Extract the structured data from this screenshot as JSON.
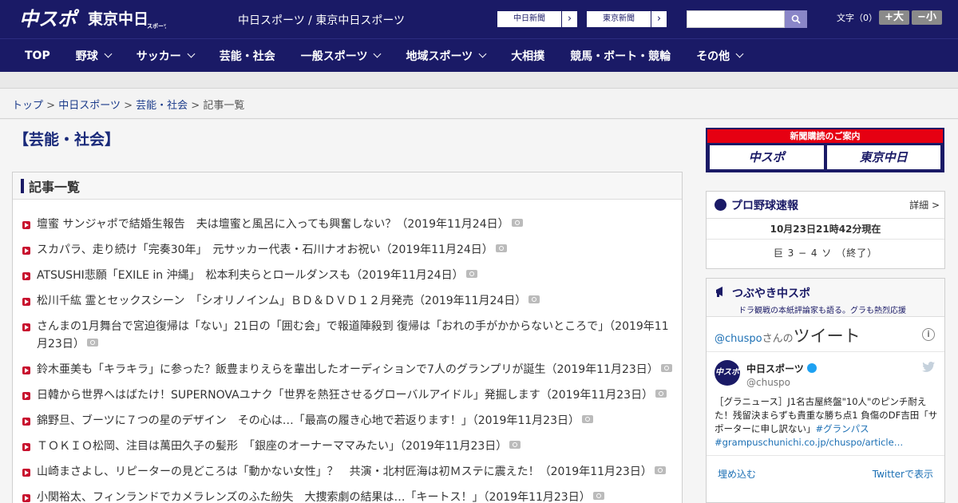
{
  "header": {
    "site_names": "中日スポーツ / 東京中日スポーツ",
    "logo_chuspo": "中スポ",
    "logo_tokyo": "東京中日",
    "logo_tokyo_small": "スポーツ",
    "ext_link_1": "中日新聞",
    "ext_link_2": "東京新聞",
    "search_placeholder": "",
    "fontsize_label": "文字（0）",
    "font_larger": "+大",
    "font_smaller": "−小"
  },
  "nav": {
    "items": [
      {
        "label": "TOP",
        "dropdown": false
      },
      {
        "label": "野球",
        "dropdown": true
      },
      {
        "label": "サッカー",
        "dropdown": true
      },
      {
        "label": "芸能・社会",
        "dropdown": false
      },
      {
        "label": "一般スポーツ",
        "dropdown": true
      },
      {
        "label": "地域スポーツ",
        "dropdown": true
      },
      {
        "label": "大相撲",
        "dropdown": false
      },
      {
        "label": "競馬・ボート・競輪",
        "dropdown": false
      },
      {
        "label": "その他",
        "dropdown": true
      }
    ]
  },
  "breadcrumb": {
    "items": [
      "トップ",
      "中日スポーツ",
      "芸能・社会"
    ],
    "separator": ">",
    "current": "記事一覧"
  },
  "page": {
    "title": "【芸能・社会】",
    "list_title": "記事一覧"
  },
  "articles": [
    {
      "text": "壇蜜 サンジャポで結婚生報告　夫は壇蜜と風呂に入っても興奮しない？（2019年11月24日）",
      "photo": true
    },
    {
      "text": "スカパラ、走り続け「完奏30年」　元サッカー代表・石川ナオお祝い（2019年11月24日）",
      "photo": true
    },
    {
      "text": "ATSUSHI悲願「EXILE in 沖縄」　松本利夫らとロールダンスも（2019年11月24日）",
      "photo": true
    },
    {
      "text": "松川千紘 霊とセックスシーン　「シオリノインム」ＢＤ＆ＤＶＤ１２月発売（2019年11月24日）",
      "photo": true
    },
    {
      "text": "さんまの1月舞台で宮迫復帰は「ない」21日の「囲む会」で報道陣殺到 復帰は「おれの手がかからないところで」（2019年11月23日）",
      "photo": true
    },
    {
      "text": "鈴木亜美も「キラキラ」に参った？飯豊まりえらを輩出したオーディションで7人のグランプリが誕生（2019年11月23日）",
      "photo": true
    },
    {
      "text": "日韓から世界へはばたけ！SUPERNOVAユナク「世界を熱狂させるグローバルアイドル」発掘します（2019年11月23日）",
      "photo": true
    },
    {
      "text": "錦野旦、ブーツに７つの星のデザイン　その心は…「最高の履き心地で若返ります！」（2019年11月23日）",
      "photo": true
    },
    {
      "text": "ＴＯＫＩＯ松岡、注目は萬田久子の髪形　「銀座のオーナーママみたい」（2019年11月23日）",
      "photo": true
    },
    {
      "text": "山崎まさよし、リピーターの見どころは「動かない女性」？　共演・北村匠海は初Ｍステに震えた！（2019年11月23日）",
      "photo": true
    },
    {
      "text": "小関裕太、フィンランドでカメラレンズのふた紛失　大捜索劇の結果は…「キートス！」（2019年11月23日）",
      "photo": true
    }
  ],
  "sidebar": {
    "subscribe": {
      "heading": "新聞購読のご案内",
      "logo1": "中スポ",
      "logo2": "東京中日"
    },
    "baseball": {
      "title": "プロ野球速報",
      "detail": "詳細 >",
      "time": "10月23日21時42分現在",
      "score": "巨 3 − 4 ソ （終了）"
    },
    "tsubuyaki": {
      "title": "つぶやき中スポ",
      "subtitle": "ドラ観戦の本紙評論家も語る。グラも熱烈応援",
      "tweets_user": "@chuspo",
      "tweets_san": "さんの",
      "tweets_label": "ツイート",
      "info": "i",
      "account_name": "中日スポーツ",
      "account_handle": "@chuspo",
      "avatar_text": "中スポ",
      "tweet_text": "［グラニュース］J1名古屋終盤\"10人\"のピンチ耐えた！残留決まらずも貴重な勝ち点1 負傷のDF吉田「サポーターに申し訳ない」",
      "tweet_hashtag": "#グランパス",
      "tweet_link": "#grampuschunichi.co.jp/chuspo/article…",
      "embed": "埋め込む",
      "view_on_twitter": "Twitterで表示"
    }
  },
  "colors": {
    "brand_navy": "#1a1a66",
    "accent_red": "#e60012",
    "link_blue": "#1b6fb4"
  }
}
